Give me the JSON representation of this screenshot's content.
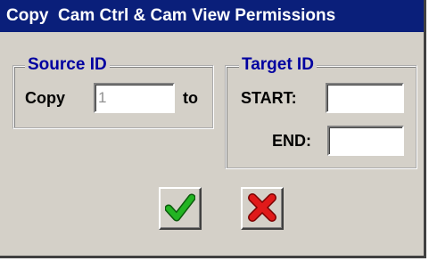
{
  "dialog": {
    "title": "Copy  Cam Ctrl & Cam View Permissions"
  },
  "source": {
    "legend": "Source ID",
    "copy_label": "Copy",
    "id_value": "1",
    "to_label": "to"
  },
  "target": {
    "legend": "Target ID",
    "start_label": "START:",
    "start_value": "",
    "end_label": "END:",
    "end_value": ""
  },
  "buttons": {
    "ok_icon": "green-checkmark-icon",
    "cancel_icon": "red-x-icon"
  },
  "colors": {
    "titlebar_bg": "#0a1f7a",
    "legend_text": "#0000a0",
    "ok": "#1f9a1f",
    "cancel": "#d01818"
  }
}
